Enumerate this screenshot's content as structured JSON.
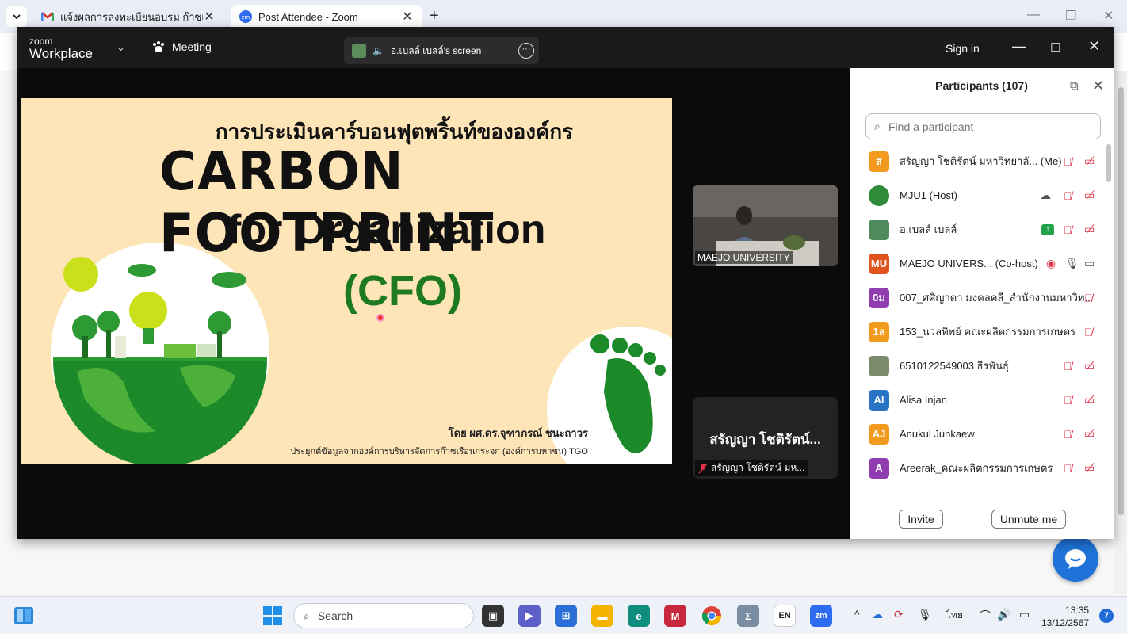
{
  "browser": {
    "tabs": [
      {
        "title": "แจ้งผลการลงทะเบียนอบรม ก๊าซเรือนก",
        "active": false
      },
      {
        "title": "Post Attendee - Zoom",
        "active": true
      }
    ],
    "new_tab": "+",
    "close_glyph": "✕"
  },
  "zoom": {
    "logo_top": "zoom",
    "logo_bottom": "Workplace",
    "meeting_label": "Meeting",
    "share_label": "อ.เบลล์ เบลล์'s screen",
    "sign_in": "Sign in"
  },
  "slide": {
    "thai_title": "การประเมินคาร์บอนฟุตพริ้นท์ขององค์กร",
    "title_line1": "CARBON FOOTPRINT",
    "title_line2": "for Organization",
    "title_line3": "(CFO)",
    "author": "โดย ผศ.ดร.จุฑาภรณ์ ชนะถาวร",
    "source": "ประยุกต์ข้อมูลจากองค์การบริหารจัดการก๊าซเรือนกระจก (องค์การมหาชน) TGO"
  },
  "videos": {
    "speaker_label": "MAEJO UNIVERSITY",
    "self_name": "สรัญญา โชติรัตน์...",
    "self_sub": "สรัญญา โชติรัตน์ มห..."
  },
  "participants": {
    "title": "Participants (107)",
    "search_placeholder": "Find a participant",
    "invite": "Invite",
    "unmute": "Unmute me",
    "list": [
      {
        "initials": "ส",
        "color": "#f29a1e",
        "name": "สรัญญา โชติรัตน์ มหาวิทยาลั...",
        "tag": "(Me)"
      },
      {
        "initials": "",
        "color": "#2e8b3a",
        "name": "MJU1 (Host)",
        "tag": ""
      },
      {
        "initials": "",
        "color": "#4f8a5c",
        "name": "อ.เบลล์ เบลล์",
        "tag": ""
      },
      {
        "initials": "MU",
        "color": "#e0541e",
        "name": "MAEJO UNIVERS...",
        "tag": "(Co-host)"
      },
      {
        "initials": "0ม",
        "color": "#8f3db0",
        "name": "007_ศศิญาดา มงคลคลี_สำนักงานมหาวิท...",
        "tag": ""
      },
      {
        "initials": "1ล",
        "color": "#f29a1e",
        "name": "153_นวลทิพย์ คณะผลิตกรรมการเกษตร",
        "tag": ""
      },
      {
        "initials": "",
        "color": "#7a8a6a",
        "name": "6510122549003 ธีรพันธุ์",
        "tag": ""
      },
      {
        "initials": "AI",
        "color": "#2a74c5",
        "name": "Alisa Injan",
        "tag": ""
      },
      {
        "initials": "AJ",
        "color": "#f29a1e",
        "name": "Anukul Junkaew",
        "tag": ""
      },
      {
        "initials": "A",
        "color": "#8f3db0",
        "name": "Areerak_คณะผลิตกรรมการเกษตร",
        "tag": ""
      }
    ]
  },
  "taskbar": {
    "search": "Search",
    "lang": "EN",
    "zoom_icon": "zm",
    "thai": "ไทย",
    "time": "13:35",
    "date": "13/12/2567",
    "notifications": "7"
  }
}
